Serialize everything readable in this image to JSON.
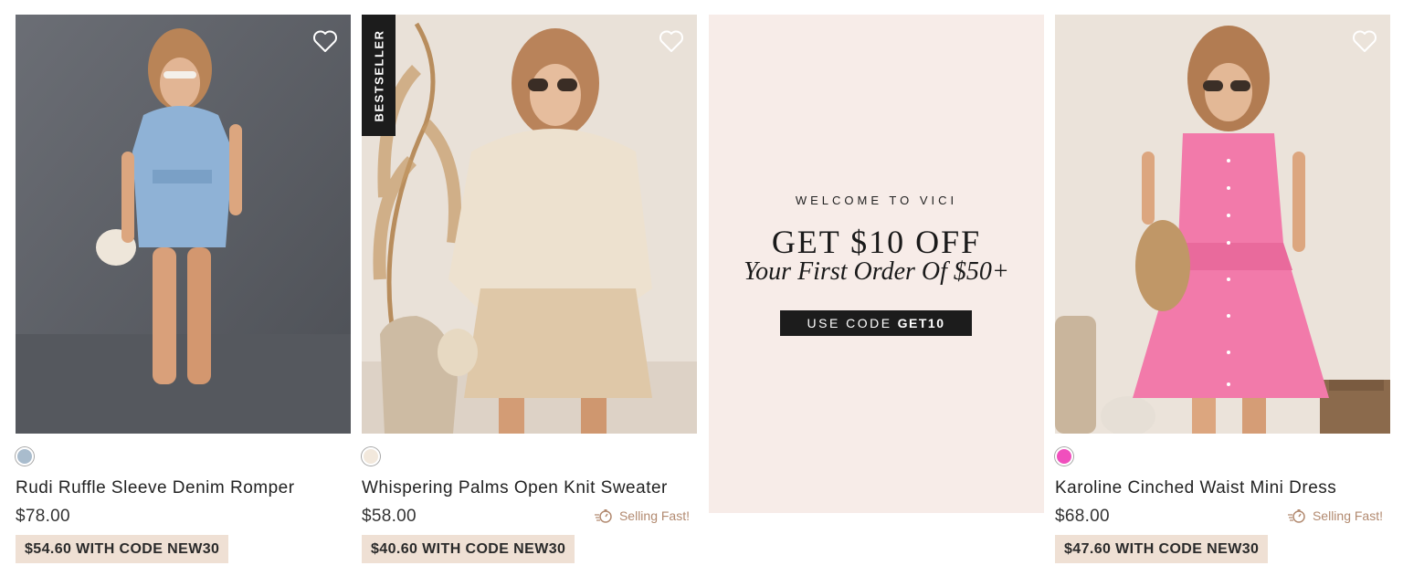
{
  "products": [
    {
      "name": "Rudi Ruffle Sleeve Denim Romper",
      "price": "$78.00",
      "promo": "$54.60 WITH CODE NEW30",
      "swatch_color": "#a9bccd",
      "selling_fast": "",
      "badge": ""
    },
    {
      "name": "Whispering Palms Open Knit Sweater",
      "price": "$58.00",
      "promo": "$40.60 WITH CODE NEW30",
      "swatch_color": "#f2e8dc",
      "selling_fast": "Selling Fast!",
      "badge": "BESTSELLER"
    },
    {
      "name": "Karoline Cinched Waist Mini Dress",
      "price": "$68.00",
      "promo": "$47.60 WITH CODE NEW30",
      "swatch_color": "#f04fbd",
      "selling_fast": "Selling Fast!",
      "badge": ""
    }
  ],
  "banner": {
    "welcome": "WELCOME TO VICI",
    "headline": "GET $10 OFF",
    "subline": "Your First Order Of $50+",
    "code_prefix": "USE CODE",
    "code": "GET10"
  },
  "icons": {
    "wishlist": "heart-outline-icon",
    "selling_fast": "stopwatch-icon"
  },
  "colors": {
    "promo_bg": "#efe0d4",
    "banner_bg": "#f7ece8",
    "accent_text": "#b28a70"
  }
}
